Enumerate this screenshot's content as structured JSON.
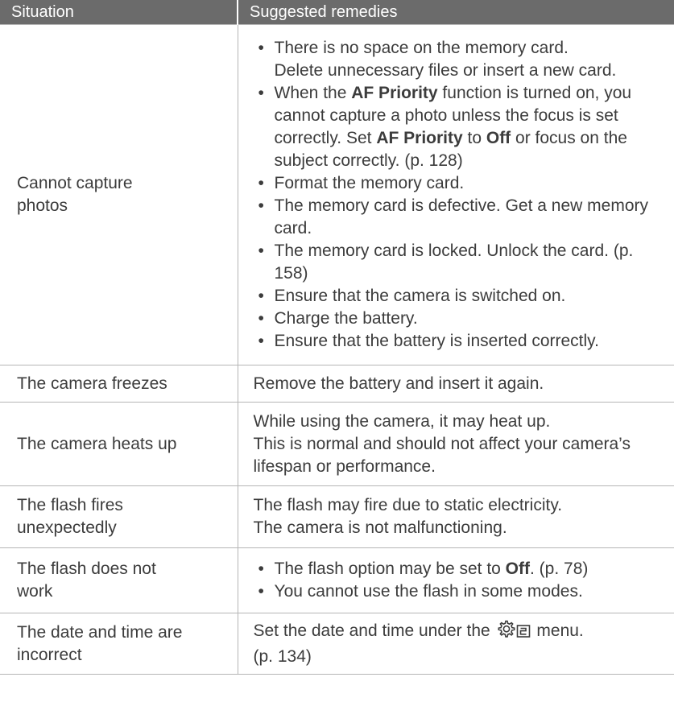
{
  "header": {
    "col1": "Situation",
    "col2": "Suggested remedies"
  },
  "rows": [
    {
      "situation": "Cannot capture photos",
      "situation_lines": [
        "Cannot capture",
        "photos"
      ],
      "remedies": [
        {
          "lines": [
            "There is no space on the memory card.",
            "Delete unnecessary files or insert a new card."
          ]
        },
        {
          "parts": [
            "When the ",
            "AF Priority",
            " function is turned on, you cannot capture a photo unless the focus is set correctly. Set ",
            "AF Priority",
            " to ",
            "Off",
            " or focus on the subject correctly. (p. 128)"
          ]
        },
        {
          "text": "Format the memory card."
        },
        {
          "text": "The memory card is defective. Get a new memory card."
        },
        {
          "text": "The memory card is locked. Unlock the card. (p. 158)"
        },
        {
          "text": "Ensure that the camera is switched on."
        },
        {
          "text": "Charge the battery."
        },
        {
          "text": "Ensure that the battery is inserted correctly."
        }
      ]
    },
    {
      "situation": "The camera freezes",
      "remedy": "Remove the battery and insert it again."
    },
    {
      "situation": "The camera heats up",
      "remedy_lines": [
        "While using the camera, it may heat up.",
        "This is normal and should not affect your camera’s lifespan or performance."
      ]
    },
    {
      "situation_lines": [
        "The flash fires",
        "unexpectedly"
      ],
      "remedy_lines": [
        "The flash may fire due to static electricity.",
        "The camera is not malfunctioning."
      ]
    },
    {
      "situation_lines": [
        "The flash does not",
        "work"
      ],
      "remedies": [
        {
          "parts": [
            "The flash option may be set to ",
            "Off",
            ". (p. 78)"
          ]
        },
        {
          "text": "You cannot use the flash in some modes."
        }
      ]
    },
    {
      "situation_lines": [
        "The date and time are",
        "incorrect"
      ],
      "remedy_parts": [
        "Set the date and time under the ",
        "menu.",
        "(p. 134)"
      ],
      "icon": "settings-gear-icon"
    }
  ],
  "colors": {
    "header_bg": "#6b6b6b",
    "header_text": "#ffffff",
    "text": "#3c3c3c",
    "border": "#b5b5b5"
  },
  "bullet": "•"
}
